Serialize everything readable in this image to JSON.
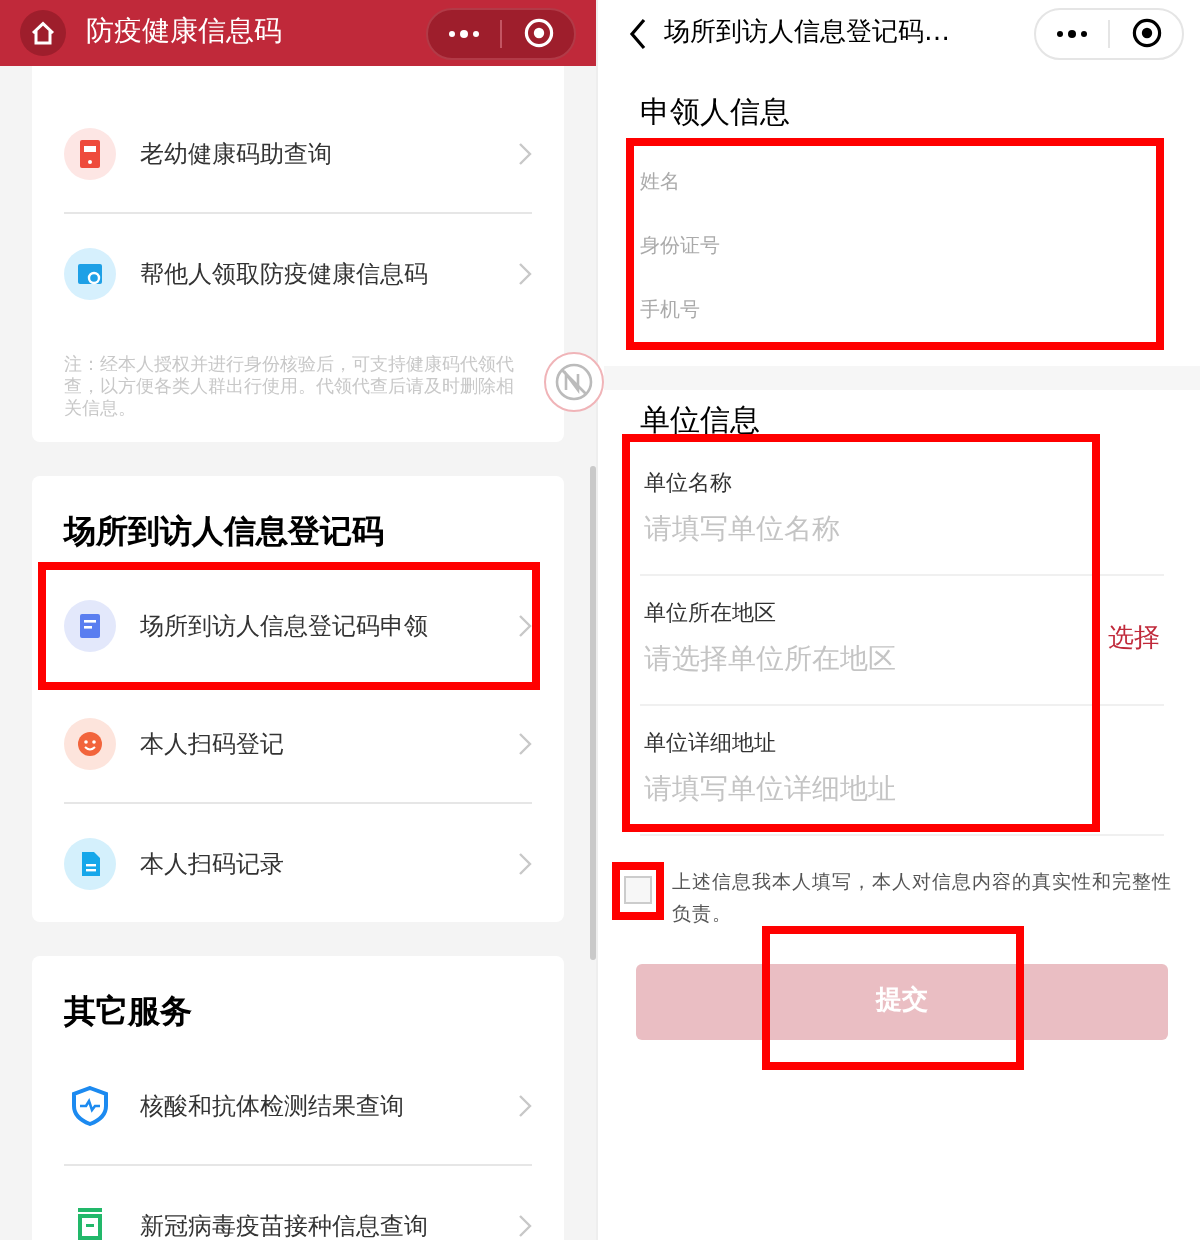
{
  "left": {
    "header": {
      "title": "防疫健康信息码"
    },
    "cards": [
      {
        "items": [
          {
            "label": "老幼健康码助查询",
            "kind": "card",
            "highlighted": false
          },
          {
            "label": "帮他人领取防疫健康信息码",
            "kind": "search",
            "highlighted": false
          }
        ],
        "note": "注：经本人授权并进行身份核验后，可支持健康码代领代查，以方便各类人群出行使用。代领代查后请及时删除相关信息。"
      },
      {
        "title": "场所到访人信息登记码",
        "items": [
          {
            "label": "场所到访人信息登记码申领",
            "kind": "doc",
            "highlighted": true
          },
          {
            "label": "本人扫码登记",
            "kind": "smile",
            "highlighted": false
          },
          {
            "label": "本人扫码记录",
            "kind": "file",
            "highlighted": false
          }
        ]
      },
      {
        "title": "其它服务",
        "items": [
          {
            "label": "核酸和抗体检测结果查询",
            "kind": "shield",
            "highlighted": false
          },
          {
            "label": "新冠病毒疫苗接种信息查询",
            "kind": "vaccine",
            "highlighted": false
          }
        ]
      }
    ]
  },
  "right": {
    "header": {
      "title": "场所到访人信息登记码…"
    },
    "applicant": {
      "title": "申领人信息",
      "highlighted": true,
      "fields": [
        {
          "placeholder": "姓名"
        },
        {
          "placeholder": "身份证号"
        },
        {
          "placeholder": "手机号"
        }
      ]
    },
    "unit": {
      "title": "单位信息",
      "highlighted": true,
      "fields": [
        {
          "label": "单位名称",
          "placeholder": "请填写单位名称"
        },
        {
          "label": "单位所在地区",
          "placeholder": "请选择单位所在地区",
          "action": "选择"
        },
        {
          "label": "单位详细地址",
          "placeholder": "请填写单位详细地址"
        }
      ]
    },
    "agreement": {
      "text": "上述信息我本人填写，本人对信息内容的真实性和完整性负责。",
      "checked": false,
      "highlighted": true
    },
    "submit": {
      "label": "提交",
      "disabled": true,
      "highlighted": true
    }
  }
}
